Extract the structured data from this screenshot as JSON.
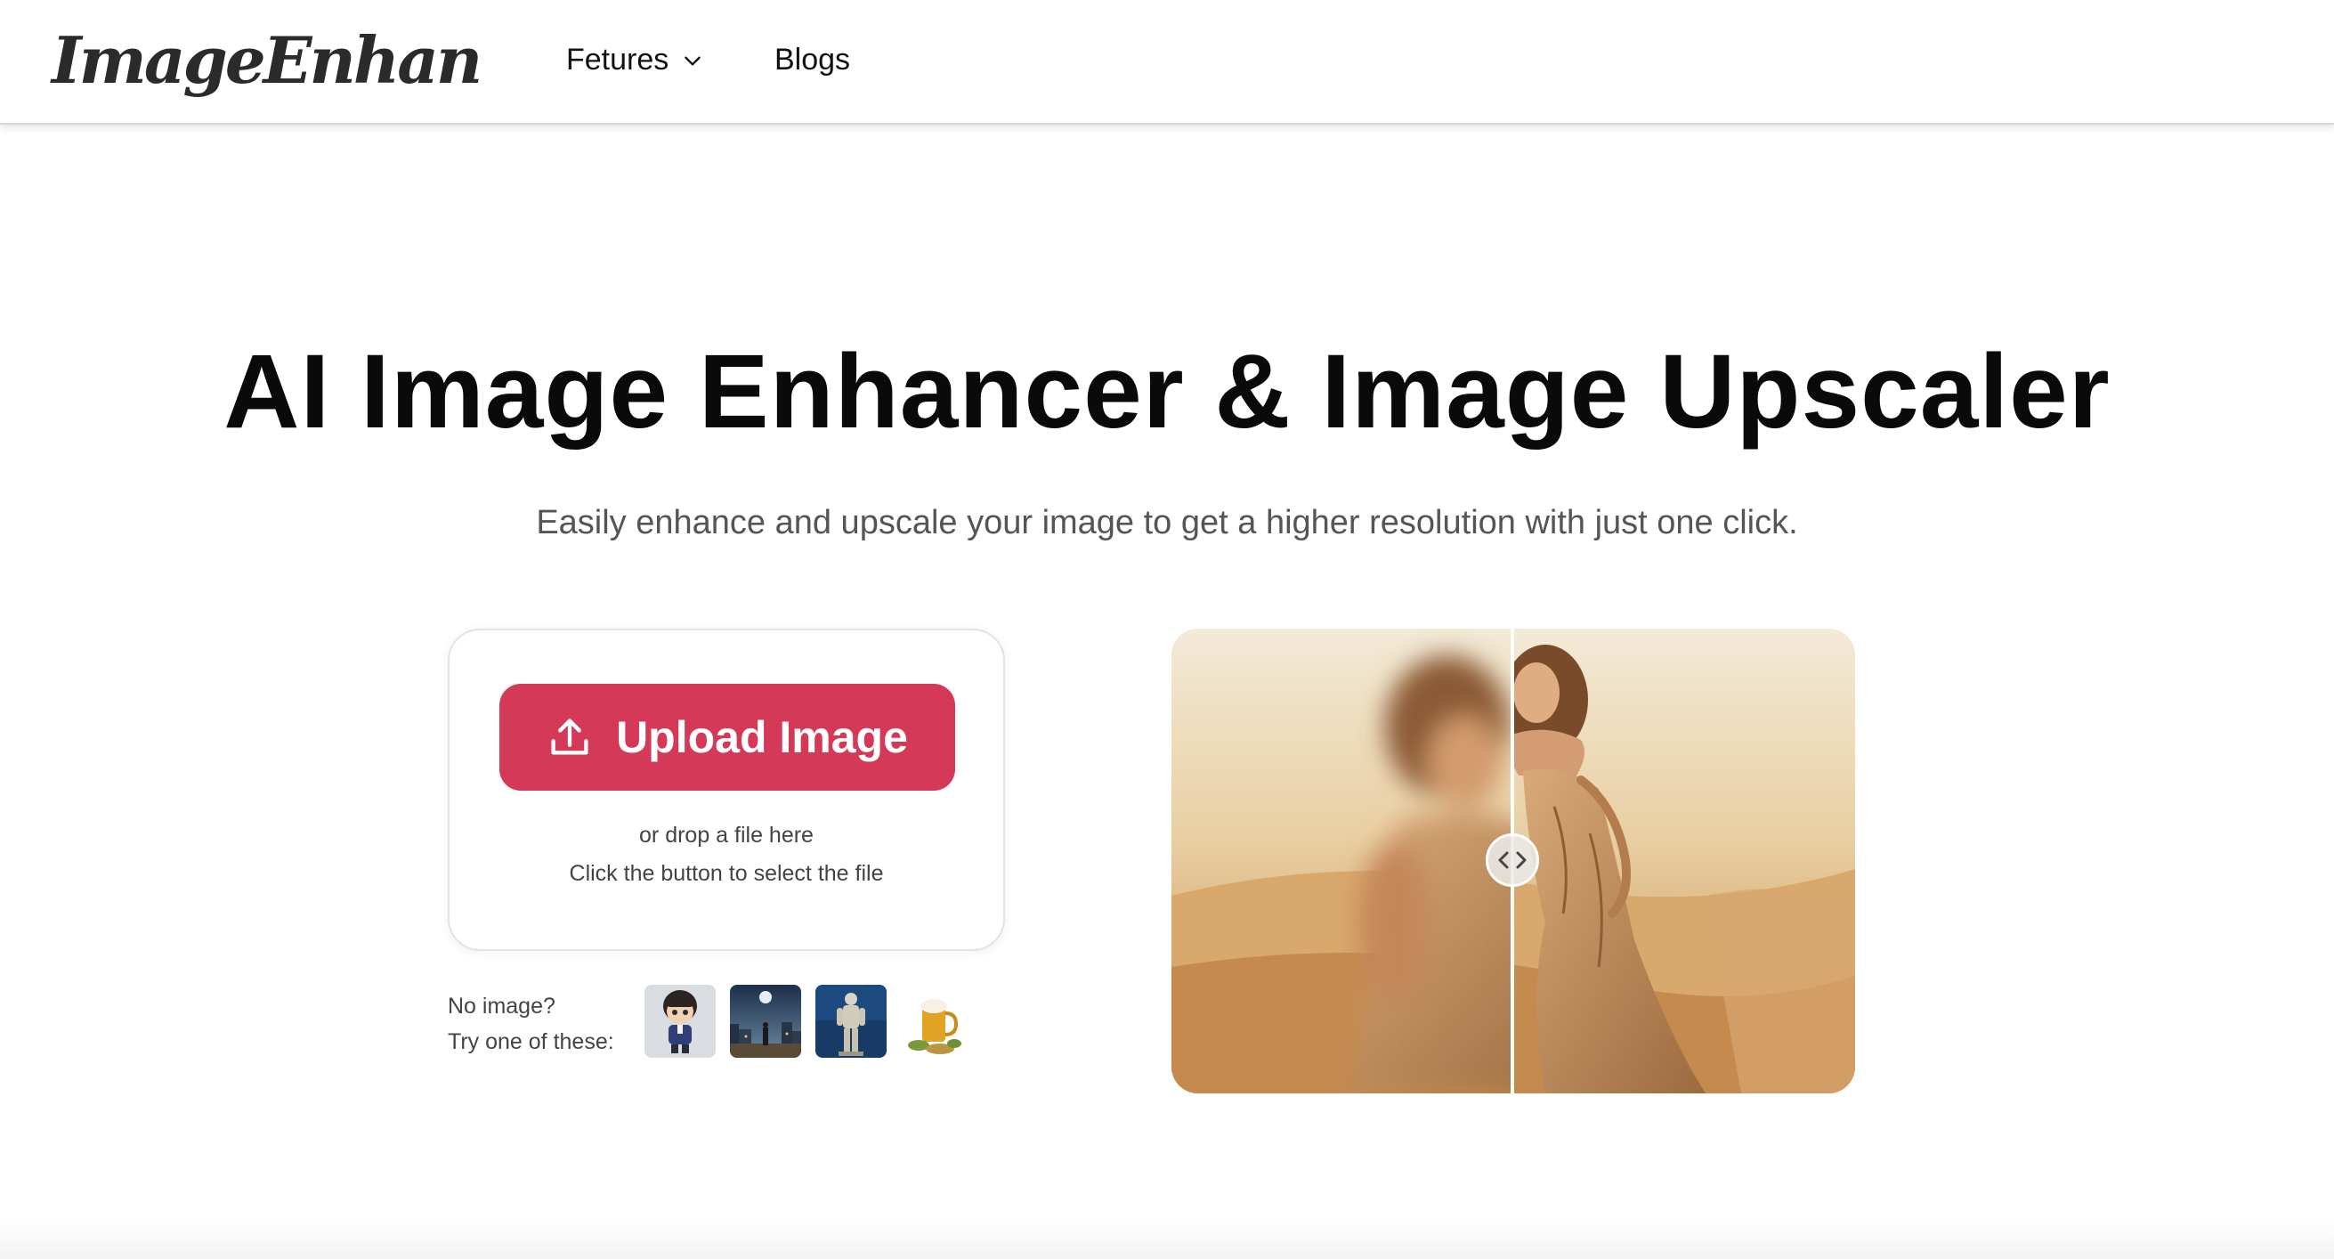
{
  "header": {
    "logo_text": "ImageEnhan",
    "nav": {
      "features_label": "Fetures",
      "blogs_label": "Blogs"
    }
  },
  "hero": {
    "title": "AI Image Enhancer & Image Upscaler",
    "subtitle": "Easily enhance and upscale your image to get a higher resolution with just one click."
  },
  "upload": {
    "button_label": "Upload Image",
    "drop_hint": "or drop a file here",
    "select_hint": "Click the button to select the file"
  },
  "samples": {
    "label_line1": "No image?",
    "label_line2": "Try one of these:",
    "thumbnails": [
      "cartoon-boy",
      "night-city",
      "statue",
      "beer-mug"
    ]
  },
  "comparison": {
    "split_fraction": 0.5,
    "left_state": "blurred",
    "right_state": "enhanced"
  },
  "colors": {
    "accent": "#d43a57",
    "text_dark": "#0a0a0a",
    "text_muted": "#555555"
  }
}
